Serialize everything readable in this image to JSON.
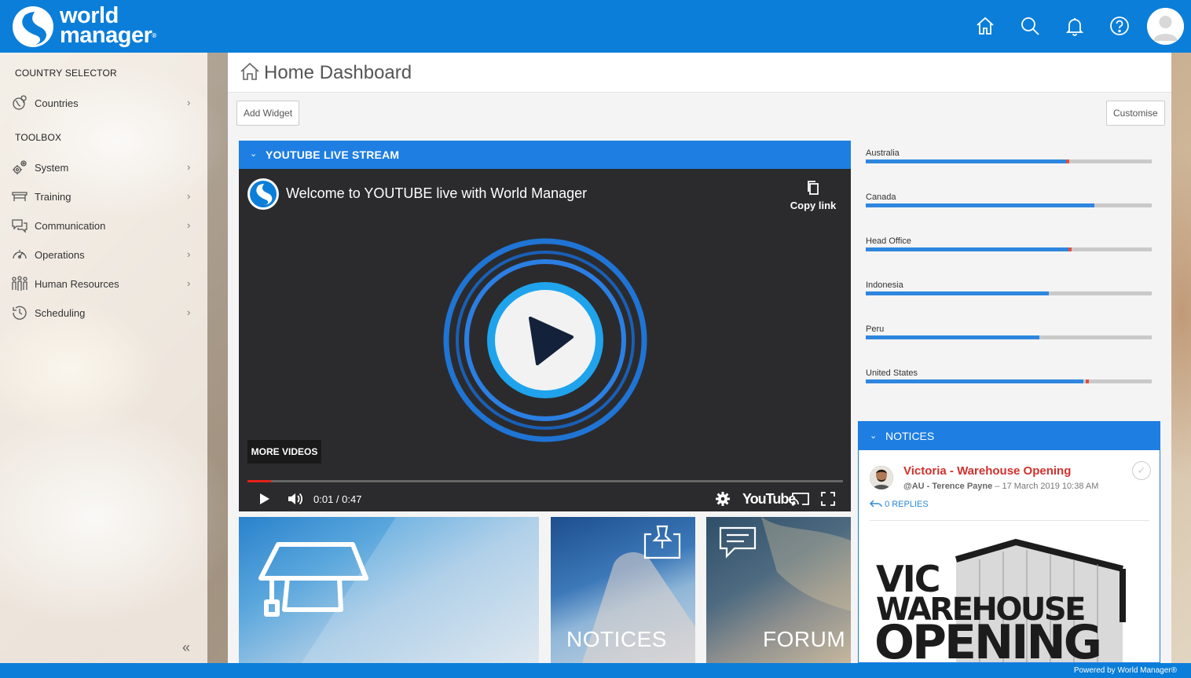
{
  "brand": {
    "line1": "world",
    "line2": "manager",
    "mark": "®"
  },
  "colors": {
    "brand_blue": "#0b7ed9",
    "widget_blue": "#1e7ee2",
    "alert_red": "#d0312d",
    "progress_red": "#e62117"
  },
  "topbar": {
    "icons": [
      "home-icon",
      "search-icon",
      "bell-icon",
      "help-icon",
      "user-avatar"
    ]
  },
  "sidebar": {
    "country_title": "COUNTRY SELECTOR",
    "countries_label": "Countries",
    "toolbox_title": "TOOLBOX",
    "items": [
      {
        "label": "System",
        "icon": "gears-icon"
      },
      {
        "label": "Training",
        "icon": "training-icon"
      },
      {
        "label": "Communication",
        "icon": "chat-icon"
      },
      {
        "label": "Operations",
        "icon": "gauge-icon"
      },
      {
        "label": "Human Resources",
        "icon": "people-icon"
      },
      {
        "label": "Scheduling",
        "icon": "clock-icon"
      }
    ],
    "chevron": "›",
    "collapse": "«"
  },
  "page": {
    "title": "Home Dashboard",
    "add_widget": "Add Widget",
    "customise": "Customise"
  },
  "youtube": {
    "widget_title": "YOUTUBE LIVE STREAM",
    "video_title": "Welcome to YOUTUBE live with World Manager",
    "copy_link": "Copy link",
    "more_videos": "MORE VIDEOS",
    "time": "0:01 / 0:47",
    "progress": 0.04,
    "yt_logo": "YouTube"
  },
  "tiles": {
    "notices": "NOTICES",
    "forum": "FORUM"
  },
  "stats": [
    {
      "label": "Australia",
      "value": 0.7,
      "marker": 0.7
    },
    {
      "label": "Canada",
      "value": 0.8,
      "marker": null
    },
    {
      "label": "Head Office",
      "value": 0.71,
      "marker": 0.71
    },
    {
      "label": "Indonesia",
      "value": 0.64,
      "marker": null
    },
    {
      "label": "Peru",
      "value": 0.607,
      "marker": null
    },
    {
      "label": "United States",
      "value": 0.76,
      "marker": 0.77
    }
  ],
  "notices": {
    "widget_title": "NOTICES",
    "title": "Victoria - Warehouse Opening",
    "author": "@AU - Terence Payne",
    "date": "– 17 March 2019 10:38 AM",
    "replies": "0 REPLIES",
    "image_lines": [
      "VIC",
      "WAREHOUSE",
      "OPENING"
    ]
  },
  "footer": {
    "text": "Powered by World Manager®"
  }
}
